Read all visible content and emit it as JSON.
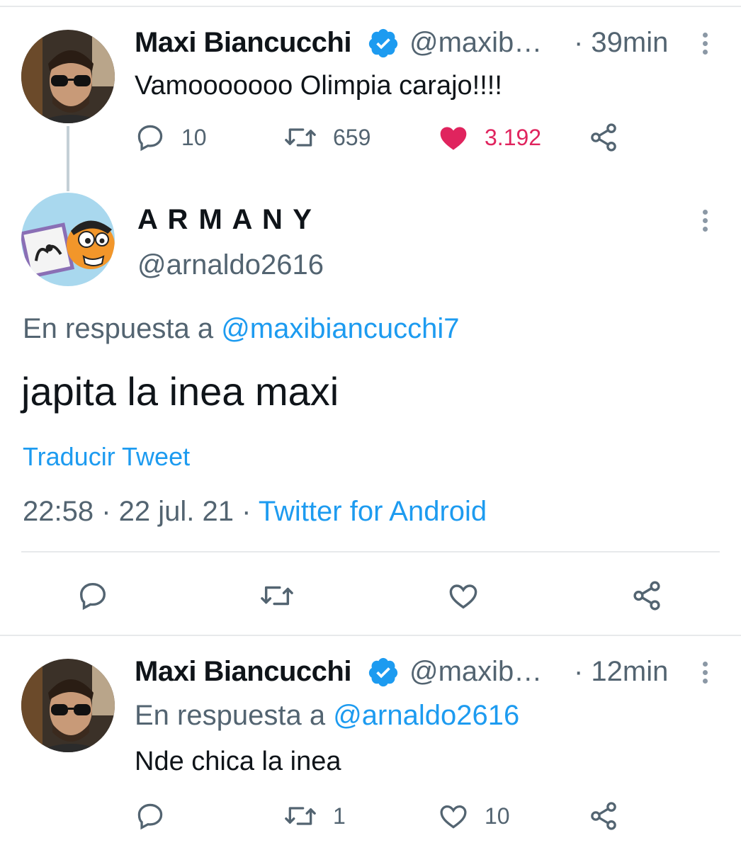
{
  "tweet1": {
    "name": "Maxi Biancucchi",
    "handle": "@maxib…",
    "time": "· 39min",
    "text": "Vamooooooo Olimpia carajo!!!!",
    "replies": "10",
    "retweets": "659",
    "likes": "3.192"
  },
  "main_tweet": {
    "name": "A R M A N Y",
    "handle": "@arnaldo2616",
    "reply_prefix": "En respuesta a ",
    "reply_to": "@maxibiancucchi7",
    "text": "japita la inea maxi",
    "translate": "Traducir Tweet",
    "timestamp": "22:58 · 22 jul. 21 · ",
    "source": "Twitter for Android"
  },
  "tweet3": {
    "name": "Maxi Biancucchi",
    "handle": "@maxib…",
    "time": "· 12min",
    "reply_prefix": "En respuesta a ",
    "reply_to": "@arnaldo2616",
    "text": "Nde chica la inea",
    "replies": "",
    "retweets": "1",
    "likes": "10"
  },
  "icons": {
    "reply": "reply-icon",
    "retweet": "retweet-icon",
    "like": "heart-icon",
    "share": "share-icon",
    "verified": "verified-badge-icon",
    "more": "more-vertical-icon"
  },
  "colors": {
    "link": "#1d9bf0",
    "like": "#e0245e",
    "secondary": "#536471",
    "verified": "#1d9bf0"
  }
}
